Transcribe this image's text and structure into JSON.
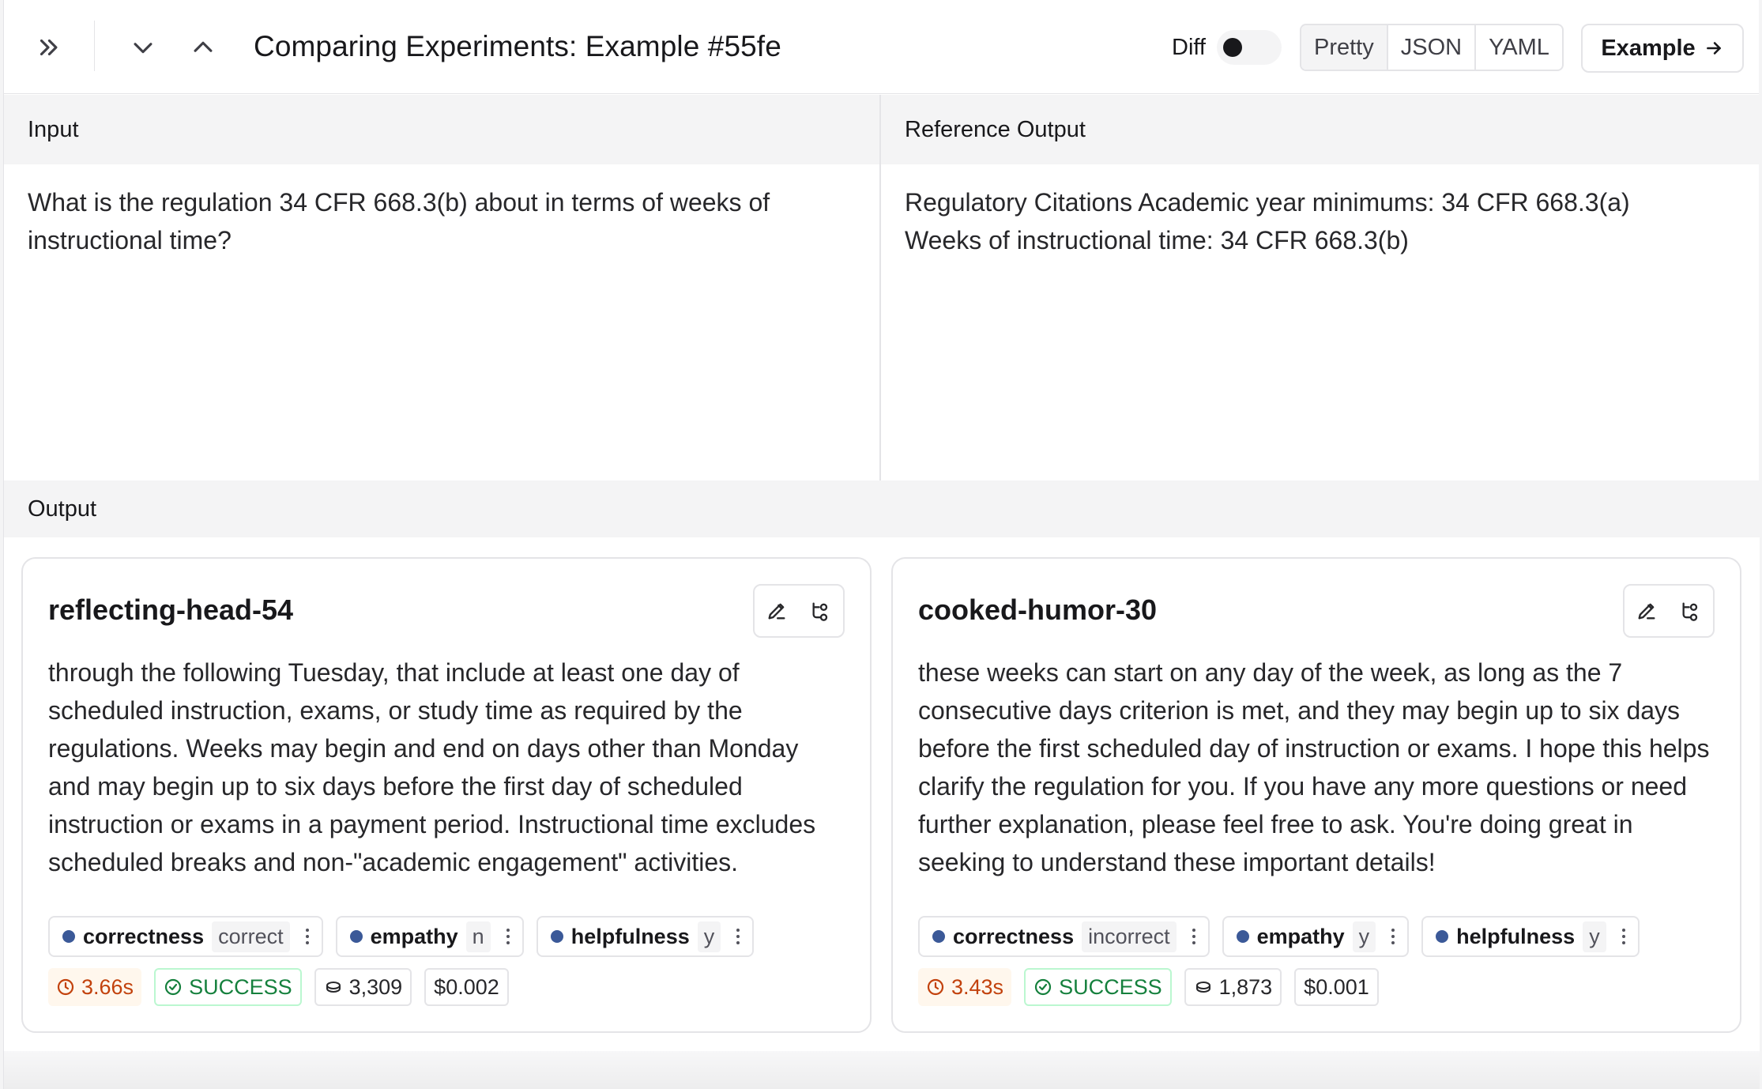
{
  "header": {
    "title": "Comparing Experiments: Example #55fe",
    "diff_label": "Diff",
    "diff_enabled": false,
    "view_modes": [
      "Pretty",
      "JSON",
      "YAML"
    ],
    "active_view_mode": "Pretty",
    "example_button": "Example"
  },
  "input": {
    "label": "Input",
    "text": "What is the regulation 34 CFR 668.3(b) about in terms of weeks of instructional time?"
  },
  "reference": {
    "label": "Reference Output",
    "text_line1": "Regulatory Citations Academic year minimums: 34 CFR 668.3(a)",
    "text_line2": "Weeks of instructional time: 34 CFR 668.3(b)"
  },
  "output": {
    "label": "Output",
    "runs": [
      {
        "name": "reflecting-head-54",
        "text": "through the following Tuesday, that include at least one day of scheduled instruction, exams, or study time as required by the regulations. Weeks may begin and end on days other than Monday and may begin up to six days before the first day of scheduled instruction or exams in a payment period. Instructional time excludes scheduled breaks and non-\"academic engagement\" activities.",
        "feedback": [
          {
            "key": "correctness",
            "value": "correct"
          },
          {
            "key": "empathy",
            "value": "n"
          },
          {
            "key": "helpfulness",
            "value": "y"
          }
        ],
        "latency": "3.66s",
        "status": "SUCCESS",
        "tokens": "3,309",
        "cost": "$0.002"
      },
      {
        "name": "cooked-humor-30",
        "text": "these weeks can start on any day of the week, as long as the 7 consecutive days criterion is met, and they may begin up to six days before the first scheduled day of instruction or exams. I hope this helps clarify the regulation for you. If you have any more questions or need further explanation, please feel free to ask. You're doing great in seeking to understand these important details!",
        "feedback": [
          {
            "key": "correctness",
            "value": "incorrect"
          },
          {
            "key": "empathy",
            "value": "y"
          },
          {
            "key": "helpfulness",
            "value": "y"
          }
        ],
        "latency": "3.43s",
        "status": "SUCCESS",
        "tokens": "1,873",
        "cost": "$0.001"
      }
    ]
  },
  "colors": {
    "feedback_dot": "#3b5998",
    "latency": "#c2410c",
    "success": "#15803d",
    "panel_bg": "#f4f4f5"
  }
}
